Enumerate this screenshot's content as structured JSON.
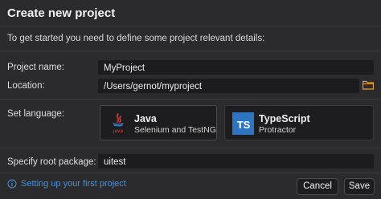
{
  "dialog": {
    "title": "Create new project",
    "intro": "To get started you need to define some project relevant details:"
  },
  "form": {
    "project_name_label": "Project name:",
    "project_name_value": "MyProject",
    "location_label": "Location:",
    "location_value": "/Users/gernot/myproject",
    "language_label": "Set language:",
    "root_package_label": "Specify root package:",
    "root_package_value": "uitest"
  },
  "languages": [
    {
      "name": "Java",
      "subtitle": "Selenium and TestNG",
      "icon": "java-icon",
      "selected": true
    },
    {
      "name": "TypeScript",
      "subtitle": "Protractor",
      "icon": "typescript-icon",
      "selected": false
    }
  ],
  "typescript_badge": "TS",
  "java_badge": "java",
  "footer": {
    "help_link": "Setting up your first project",
    "cancel_label": "Cancel",
    "save_label": "Save"
  },
  "colors": {
    "background": "#2b2b2d",
    "field": "#1c1c1e",
    "link": "#4b8fd6",
    "folder": "#e8a13a",
    "typescript_blue": "#2f74c0",
    "java_red": "#e23a32"
  }
}
